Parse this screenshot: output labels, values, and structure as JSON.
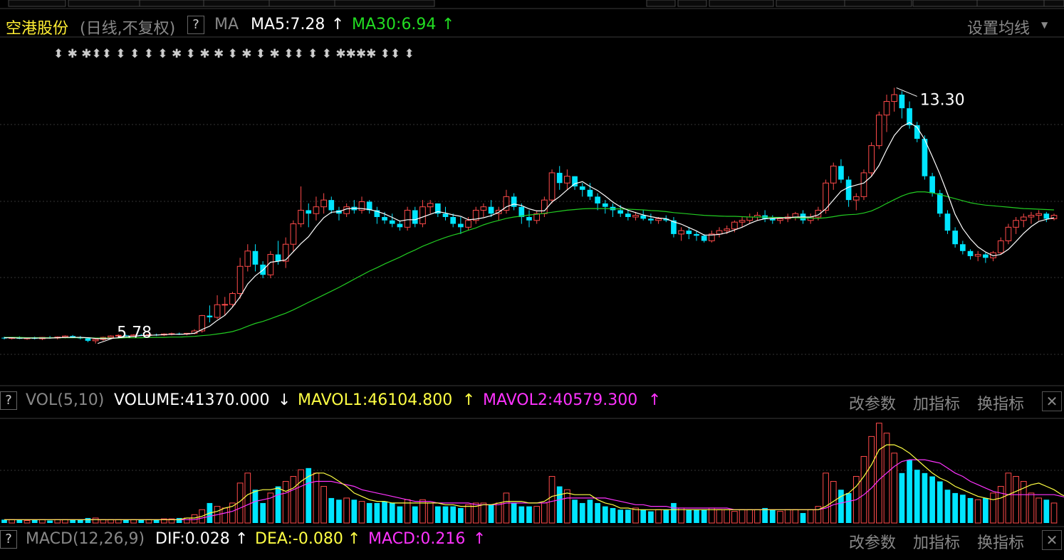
{
  "header": {
    "stock_name": "空港股份",
    "period": "(日线,不复权)",
    "help": "?",
    "indicator": "MA",
    "ma5": "MA5:7.28",
    "ma5_arrow": "↑",
    "ma30": "MA30:6.94",
    "ma30_arrow": "↑",
    "settings": "设置均线",
    "settings_arrow": "▼"
  },
  "vol_panel": {
    "help": "?",
    "name": "VOL(5,10)",
    "volume": "VOLUME:41370.000",
    "volume_arrow": "↓",
    "mavol1": "MAVOL1:46104.800",
    "mavol1_arrow": "↑",
    "mavol2": "MAVOL2:40579.300",
    "mavol2_arrow": "↑",
    "btn_params": "改参数",
    "btn_add": "加指标",
    "btn_switch": "换指标",
    "close": "✕"
  },
  "macd_panel": {
    "help": "?",
    "name": "MACD(12,26,9)",
    "dif": "DIF:0.028",
    "dif_arrow": "↑",
    "dea": "DEA:-0.080",
    "dea_arrow": "↑",
    "macd": "MACD:0.216",
    "macd_arrow": "↑",
    "btn_params": "改参数",
    "btn_add": "加指标",
    "btn_switch": "换指标",
    "close": "✕"
  },
  "colors": {
    "up": "#ff4a4a",
    "down": "#00e5ff",
    "ma5": "#ffffff",
    "ma30": "#22cc22",
    "mavol1": "#ffff44",
    "mavol2": "#ff33ff",
    "grid": "#333333"
  },
  "chart_data": {
    "type": "candlestick",
    "max_label": "13.30",
    "min_label": "5.78",
    "price_range": [
      5.0,
      14.0
    ],
    "event_markers": "⬍ ✱ ✱⬍⬍ ⬍ ⬍ ⬍ ⬍ ✱ ⬍ ✱ ✱ ⬍ ✱ ⬍ ✱ ⬍⬍ ⬍ ⬍ ✱✱✱✱ ⬍⬍ ⬍",
    "ohlc": [
      [
        5.95,
        5.98,
        5.9,
        5.93
      ],
      [
        5.93,
        5.97,
        5.9,
        5.96
      ],
      [
        5.96,
        5.99,
        5.91,
        5.92
      ],
      [
        5.92,
        5.96,
        5.89,
        5.95
      ],
      [
        5.95,
        5.98,
        5.9,
        5.92
      ],
      [
        5.92,
        5.97,
        5.88,
        5.96
      ],
      [
        5.96,
        6.0,
        5.92,
        5.94
      ],
      [
        5.94,
        5.99,
        5.9,
        5.97
      ],
      [
        5.97,
        6.02,
        5.93,
        6.0
      ],
      [
        6.0,
        6.03,
        5.94,
        5.96
      ],
      [
        5.96,
        6.0,
        5.9,
        5.93
      ],
      [
        5.93,
        5.96,
        5.82,
        5.86
      ],
      [
        5.86,
        5.92,
        5.78,
        5.9
      ],
      [
        5.9,
        5.98,
        5.86,
        5.96
      ],
      [
        5.96,
        6.02,
        5.92,
        6.0
      ],
      [
        6.0,
        6.05,
        5.96,
        6.02
      ],
      [
        6.02,
        6.04,
        5.98,
        6.0
      ],
      [
        6.0,
        6.05,
        5.97,
        6.03
      ],
      [
        6.03,
        6.06,
        6.0,
        6.02
      ],
      [
        6.02,
        6.06,
        5.98,
        6.04
      ],
      [
        6.04,
        6.07,
        6.0,
        6.03
      ],
      [
        6.03,
        6.08,
        6.0,
        6.06
      ],
      [
        6.06,
        6.1,
        6.02,
        6.07
      ],
      [
        6.07,
        6.1,
        6.03,
        6.06
      ],
      [
        6.06,
        6.09,
        6.02,
        6.08
      ],
      [
        6.08,
        6.2,
        6.05,
        6.15
      ],
      [
        6.15,
        6.62,
        6.1,
        6.6
      ],
      [
        6.6,
        6.9,
        6.4,
        6.55
      ],
      [
        6.55,
        7.2,
        6.5,
        6.92
      ],
      [
        6.92,
        7.15,
        6.6,
        6.93
      ],
      [
        6.93,
        7.3,
        6.85,
        7.25
      ],
      [
        7.25,
        8.3,
        7.1,
        8.05
      ],
      [
        8.05,
        8.7,
        7.9,
        8.5
      ],
      [
        8.5,
        8.7,
        7.9,
        8.1
      ],
      [
        8.1,
        8.2,
        7.7,
        7.8
      ],
      [
        7.8,
        8.5,
        7.7,
        8.4
      ],
      [
        8.4,
        8.8,
        8.1,
        8.2
      ],
      [
        8.2,
        8.9,
        8.0,
        8.7
      ],
      [
        8.7,
        9.4,
        8.5,
        9.3
      ],
      [
        9.3,
        10.4,
        9.2,
        9.7
      ],
      [
        9.7,
        9.9,
        9.2,
        9.6
      ],
      [
        9.6,
        10.1,
        9.4,
        9.8
      ],
      [
        9.8,
        10.2,
        9.6,
        10.0
      ],
      [
        10.0,
        10.1,
        9.6,
        9.7
      ],
      [
        9.7,
        9.8,
        9.4,
        9.6
      ],
      [
        9.6,
        9.9,
        9.5,
        9.8
      ],
      [
        9.8,
        10.0,
        9.6,
        9.7
      ],
      [
        9.7,
        10.1,
        9.6,
        9.95
      ],
      [
        9.95,
        10.0,
        9.6,
        9.7
      ],
      [
        9.7,
        9.8,
        9.3,
        9.5
      ],
      [
        9.5,
        9.65,
        9.3,
        9.4
      ],
      [
        9.4,
        9.6,
        9.2,
        9.3
      ],
      [
        9.3,
        9.4,
        9.1,
        9.2
      ],
      [
        9.2,
        9.8,
        9.1,
        9.7
      ],
      [
        9.7,
        9.8,
        9.2,
        9.3
      ],
      [
        9.3,
        10.0,
        9.2,
        9.8
      ],
      [
        9.8,
        10.0,
        9.6,
        9.9
      ],
      [
        9.9,
        9.9,
        9.5,
        9.6
      ],
      [
        9.6,
        9.8,
        9.4,
        9.5
      ],
      [
        9.5,
        9.6,
        9.2,
        9.3
      ],
      [
        9.3,
        9.5,
        9.0,
        9.2
      ],
      [
        9.2,
        9.5,
        9.1,
        9.4
      ],
      [
        9.4,
        9.8,
        9.3,
        9.7
      ],
      [
        9.7,
        9.9,
        9.5,
        9.8
      ],
      [
        9.8,
        10.0,
        9.5,
        9.6
      ],
      [
        9.6,
        9.8,
        9.4,
        9.7
      ],
      [
        9.7,
        10.3,
        9.6,
        10.1
      ],
      [
        10.1,
        10.2,
        9.7,
        9.8
      ],
      [
        9.8,
        9.9,
        9.3,
        9.5
      ],
      [
        9.5,
        9.7,
        9.2,
        9.4
      ],
      [
        9.4,
        9.7,
        9.3,
        9.6
      ],
      [
        9.6,
        10.1,
        9.5,
        10.0
      ],
      [
        10.0,
        10.9,
        9.9,
        10.8
      ],
      [
        10.8,
        11.0,
        10.3,
        10.5
      ],
      [
        10.5,
        10.9,
        10.3,
        10.7
      ],
      [
        10.7,
        10.7,
        10.3,
        10.4
      ],
      [
        10.4,
        10.5,
        10.1,
        10.3
      ],
      [
        10.3,
        10.5,
        10.0,
        10.1
      ],
      [
        10.1,
        10.2,
        9.7,
        9.9
      ],
      [
        9.9,
        10.0,
        9.6,
        9.8
      ],
      [
        9.8,
        9.9,
        9.5,
        9.7
      ],
      [
        9.7,
        9.85,
        9.5,
        9.6
      ],
      [
        9.6,
        9.7,
        9.4,
        9.5
      ],
      [
        9.5,
        9.65,
        9.4,
        9.55
      ],
      [
        9.55,
        9.7,
        9.4,
        9.45
      ],
      [
        9.45,
        9.6,
        9.3,
        9.4
      ],
      [
        9.4,
        9.5,
        9.3,
        9.45
      ],
      [
        9.45,
        9.55,
        9.35,
        9.4
      ],
      [
        9.4,
        9.5,
        8.9,
        9.0
      ],
      [
        9.0,
        9.2,
        8.8,
        9.1
      ],
      [
        9.1,
        9.2,
        8.85,
        9.0
      ],
      [
        9.0,
        9.1,
        8.8,
        8.95
      ],
      [
        8.95,
        9.0,
        8.75,
        8.8
      ],
      [
        8.8,
        9.1,
        8.75,
        9.0
      ],
      [
        9.0,
        9.2,
        8.9,
        9.1
      ],
      [
        9.1,
        9.25,
        9.0,
        9.15
      ],
      [
        9.15,
        9.4,
        9.05,
        9.35
      ],
      [
        9.35,
        9.5,
        9.2,
        9.4
      ],
      [
        9.4,
        9.6,
        9.3,
        9.5
      ],
      [
        9.5,
        9.65,
        9.4,
        9.55
      ],
      [
        9.55,
        9.7,
        9.35,
        9.45
      ],
      [
        9.45,
        9.55,
        9.3,
        9.4
      ],
      [
        9.4,
        9.5,
        9.3,
        9.45
      ],
      [
        9.45,
        9.6,
        9.35,
        9.5
      ],
      [
        9.5,
        9.65,
        9.4,
        9.6
      ],
      [
        9.6,
        9.7,
        9.3,
        9.4
      ],
      [
        9.4,
        9.6,
        9.3,
        9.5
      ],
      [
        9.5,
        9.8,
        9.4,
        9.7
      ],
      [
        9.7,
        10.6,
        9.6,
        10.5
      ],
      [
        10.5,
        11.1,
        10.3,
        11.0
      ],
      [
        11.0,
        11.2,
        10.5,
        10.6
      ],
      [
        10.6,
        10.7,
        9.8,
        10.0
      ],
      [
        10.0,
        10.2,
        9.7,
        10.1
      ],
      [
        10.1,
        10.9,
        10.0,
        10.8
      ],
      [
        10.8,
        11.7,
        10.7,
        11.6
      ],
      [
        11.6,
        12.6,
        11.5,
        12.5
      ],
      [
        12.5,
        13.1,
        12.0,
        12.9
      ],
      [
        12.9,
        13.3,
        12.6,
        13.1
      ],
      [
        13.1,
        13.2,
        12.4,
        12.7
      ],
      [
        12.7,
        12.9,
        12.1,
        12.2
      ],
      [
        12.2,
        12.3,
        11.7,
        11.8
      ],
      [
        11.8,
        11.9,
        10.6,
        10.7
      ],
      [
        10.7,
        10.8,
        10.1,
        10.2
      ],
      [
        10.2,
        10.3,
        9.5,
        9.6
      ],
      [
        9.6,
        9.7,
        9.0,
        9.1
      ],
      [
        9.1,
        9.2,
        8.6,
        8.7
      ],
      [
        8.7,
        8.8,
        8.4,
        8.5
      ],
      [
        8.5,
        8.55,
        8.25,
        8.35
      ],
      [
        8.35,
        8.5,
        8.2,
        8.4
      ],
      [
        8.4,
        8.45,
        8.15,
        8.3
      ],
      [
        8.3,
        8.5,
        8.2,
        8.45
      ],
      [
        8.45,
        8.9,
        8.4,
        8.8
      ],
      [
        8.8,
        9.3,
        8.7,
        9.2
      ],
      [
        9.2,
        9.5,
        9.0,
        9.4
      ],
      [
        9.4,
        9.6,
        9.2,
        9.5
      ],
      [
        9.5,
        9.65,
        9.3,
        9.55
      ],
      [
        9.55,
        9.7,
        9.4,
        9.6
      ],
      [
        9.6,
        9.65,
        9.35,
        9.45
      ],
      [
        9.45,
        9.6,
        9.4,
        9.55
      ]
    ],
    "ma5": [
      5.95,
      5.95,
      5.94,
      5.94,
      5.94,
      5.94,
      5.94,
      5.95,
      5.96,
      5.96,
      5.96,
      5.95,
      5.93,
      5.92,
      5.93,
      5.95,
      5.97,
      5.99,
      6.01,
      6.02,
      6.03,
      6.04,
      6.05,
      6.05,
      6.06,
      6.08,
      6.19,
      6.29,
      6.46,
      6.61,
      6.85,
      7.15,
      7.53,
      7.77,
      7.94,
      8.17,
      8.2,
      8.24,
      8.48,
      8.72,
      8.92,
      9.22,
      9.48,
      9.64,
      9.66,
      9.74,
      9.76,
      9.75,
      9.72,
      9.67,
      9.59,
      9.49,
      9.38,
      9.42,
      9.42,
      9.5,
      9.58,
      9.66,
      9.62,
      9.56,
      9.52,
      9.42,
      9.44,
      9.48,
      9.54,
      9.64,
      9.8,
      9.88,
      9.84,
      9.74,
      9.68,
      9.68,
      9.94,
      10.1,
      10.3,
      10.48,
      10.54,
      10.4,
      10.28,
      10.12,
      9.94,
      9.8,
      9.7,
      9.63,
      9.56,
      9.51,
      9.47,
      9.45,
      9.36,
      9.29,
      9.19,
      9.09,
      8.97,
      8.97,
      8.99,
      9.04,
      9.12,
      9.2,
      9.31,
      9.4,
      9.45,
      9.46,
      9.47,
      9.48,
      9.5,
      9.5,
      9.5,
      9.56,
      9.74,
      10.0,
      10.26,
      10.38,
      10.44,
      10.5,
      10.7,
      11.02,
      11.48,
      11.9,
      12.16,
      12.28,
      12.14,
      11.78,
      11.28,
      10.76,
      10.18,
      9.58,
      9.16,
      8.86,
      8.62,
      8.47,
      8.36,
      8.4,
      8.55,
      8.78,
      9.02,
      9.22,
      9.37,
      9.43,
      9.48
    ],
    "ma30": [
      5.96,
      5.96,
      5.96,
      5.95,
      5.95,
      5.95,
      5.95,
      5.95,
      5.95,
      5.95,
      5.95,
      5.95,
      5.94,
      5.94,
      5.94,
      5.94,
      5.95,
      5.95,
      5.95,
      5.96,
      5.96,
      5.96,
      5.97,
      5.97,
      5.98,
      5.99,
      6.01,
      6.03,
      6.06,
      6.09,
      6.13,
      6.2,
      6.29,
      6.37,
      6.43,
      6.51,
      6.59,
      6.67,
      6.77,
      6.88,
      6.99,
      7.1,
      7.21,
      7.32,
      7.43,
      7.55,
      7.67,
      7.79,
      7.91,
      8.01,
      8.12,
      8.22,
      8.32,
      8.43,
      8.53,
      8.64,
      8.73,
      8.82,
      8.9,
      8.97,
      9.03,
      9.11,
      9.18,
      9.27,
      9.34,
      9.4,
      9.46,
      9.5,
      9.53,
      9.56,
      9.58,
      9.61,
      9.64,
      9.67,
      9.7,
      9.72,
      9.74,
      9.75,
      9.75,
      9.75,
      9.74,
      9.74,
      9.73,
      9.72,
      9.71,
      9.69,
      9.68,
      9.66,
      9.63,
      9.61,
      9.59,
      9.57,
      9.55,
      9.54,
      9.53,
      9.52,
      9.52,
      9.51,
      9.5,
      9.5,
      9.5,
      9.49,
      9.49,
      9.48,
      9.48,
      9.47,
      9.47,
      9.46,
      9.48,
      9.51,
      9.55,
      9.57,
      9.58,
      9.62,
      9.68,
      9.78,
      9.9,
      10.01,
      10.12,
      10.2,
      10.24,
      10.24,
      10.21,
      10.16,
      10.1,
      10.04,
      9.98,
      9.92,
      9.88,
      9.85,
      9.83,
      9.81,
      9.79,
      9.77,
      9.75,
      9.74,
      9.73,
      9.72,
      9.71
    ],
    "volume": [
      2,
      2,
      2,
      1.5,
      2,
      2,
      1.5,
      2,
      2,
      2,
      2,
      3,
      3,
      2,
      2,
      2,
      2,
      2,
      2,
      2,
      2,
      2.5,
      2.5,
      3,
      3,
      5,
      8,
      12,
      10,
      9,
      12,
      24,
      30,
      20,
      12,
      18,
      22,
      25,
      28,
      32,
      33,
      30,
      22,
      15,
      14,
      15,
      14,
      13,
      12,
      12,
      13,
      12,
      10,
      14,
      10,
      14,
      12,
      10,
      10,
      10,
      9,
      11,
      12,
      12,
      11,
      12,
      18,
      12,
      10,
      10,
      10,
      12,
      28,
      22,
      20,
      14,
      12,
      14,
      12,
      10,
      9,
      8,
      8,
      9,
      8,
      7,
      8,
      8,
      12,
      9,
      8,
      8,
      8,
      9,
      8,
      8,
      7,
      8,
      8,
      8,
      9,
      8,
      7,
      8,
      8,
      6,
      8,
      10,
      30,
      25,
      20,
      18,
      28,
      40,
      52,
      60,
      54,
      42,
      30,
      38,
      32,
      30,
      28,
      25,
      20,
      18,
      17,
      15,
      14,
      15,
      18,
      22,
      30,
      28,
      25,
      18,
      15,
      14,
      12
    ],
    "mavol1": [
      2,
      2,
      2,
      2,
      2,
      2,
      2,
      2,
      2,
      2,
      2,
      2,
      2,
      2,
      2,
      2,
      2,
      2,
      2,
      2,
      2,
      2,
      2,
      2,
      3,
      3,
      4,
      6,
      7,
      9,
      10,
      13,
      17,
      19,
      20,
      20,
      21,
      19,
      21,
      25,
      28,
      30,
      30,
      28,
      25,
      22,
      18,
      16,
      14,
      13,
      13,
      12,
      12,
      12,
      12,
      12,
      12,
      12,
      11,
      11,
      10,
      10,
      10,
      11,
      11,
      12,
      13,
      13,
      13,
      12,
      12,
      13,
      16,
      17,
      18,
      17,
      17,
      17,
      14,
      12,
      11,
      9,
      9,
      8,
      8,
      8,
      8,
      8,
      8,
      8,
      8,
      8,
      8,
      8,
      8,
      8,
      8,
      8,
      8,
      8,
      8,
      8,
      8,
      8,
      8,
      8,
      8,
      8,
      10,
      13,
      16,
      18,
      22,
      28,
      35,
      44,
      47,
      47,
      45,
      42,
      38,
      34,
      30,
      27,
      25,
      22,
      20,
      18,
      16,
      15,
      14,
      15,
      17,
      19,
      21,
      23,
      24,
      22,
      20,
      17,
      15
    ],
    "mavol2": [
      2,
      2,
      2,
      2,
      2,
      2,
      2,
      2,
      2,
      2,
      2,
      2,
      2,
      2,
      2,
      2,
      2,
      2,
      2,
      2,
      2,
      2,
      2,
      2,
      2,
      2,
      3,
      4,
      5,
      6,
      7,
      9,
      11,
      13,
      14,
      15,
      17,
      18,
      20,
      22,
      24,
      25,
      25,
      25,
      24,
      23,
      22,
      20,
      19,
      18,
      17,
      16,
      15,
      14,
      13,
      13,
      13,
      12,
      12,
      12,
      12,
      12,
      11,
      11,
      11,
      11,
      12,
      12,
      12,
      12,
      12,
      12,
      13,
      14,
      15,
      15,
      15,
      15,
      15,
      15,
      14,
      13,
      12,
      11,
      11,
      10,
      10,
      10,
      9,
      9,
      9,
      9,
      9,
      9,
      9,
      9,
      8,
      8,
      8,
      8,
      8,
      8,
      8,
      8,
      8,
      8,
      8,
      8,
      9,
      11,
      12,
      13,
      14,
      17,
      21,
      26,
      30,
      34,
      37,
      38,
      38,
      38,
      37,
      36,
      33,
      30,
      28,
      25,
      23,
      21,
      19,
      18,
      17,
      17,
      17,
      17,
      17,
      17,
      17,
      16,
      15
    ],
    "vol_range": [
      0,
      62
    ],
    "vol_series": [
      "VOLUME",
      "MAVOL1",
      "MAVOL2"
    ],
    "price_series": [
      "MA5",
      "MA30"
    ]
  }
}
